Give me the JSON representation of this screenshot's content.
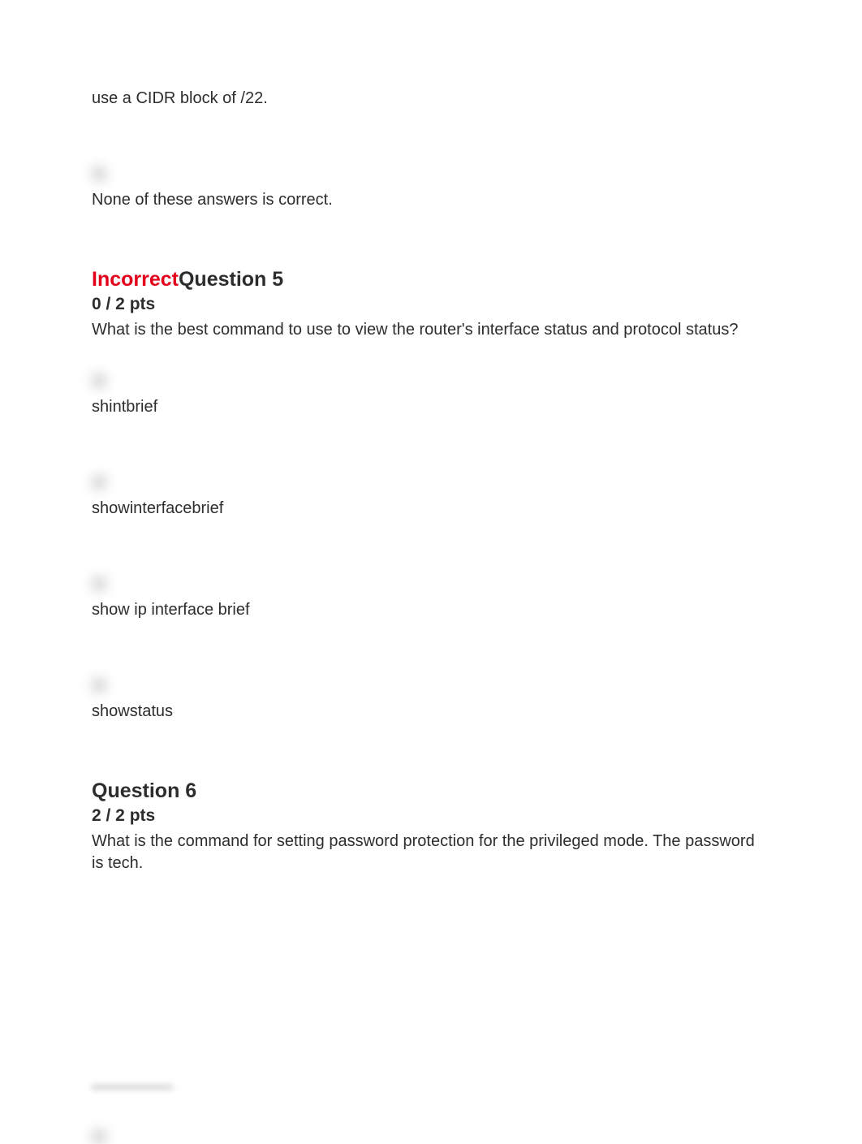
{
  "prev_question_tail": {
    "answers": [
      {
        "text": "use a CIDR block of /22."
      },
      {
        "text": "None of these answers is correct."
      }
    ]
  },
  "question5": {
    "status_label": "Incorrect",
    "title_label": "Question 5",
    "points": "0 / 2 pts",
    "prompt": "What is the best command to use to view the router's interface status and protocol status?",
    "answers": [
      {
        "text": "shintbrief"
      },
      {
        "text": "showinterfacebrief"
      },
      {
        "text": "show ip interface brief"
      },
      {
        "text": "showstatus"
      }
    ]
  },
  "question6": {
    "title_label": "Question 6",
    "points": "2 / 2 pts",
    "prompt": "What is the command for setting password protection for the privileged mode. The password is tech."
  }
}
